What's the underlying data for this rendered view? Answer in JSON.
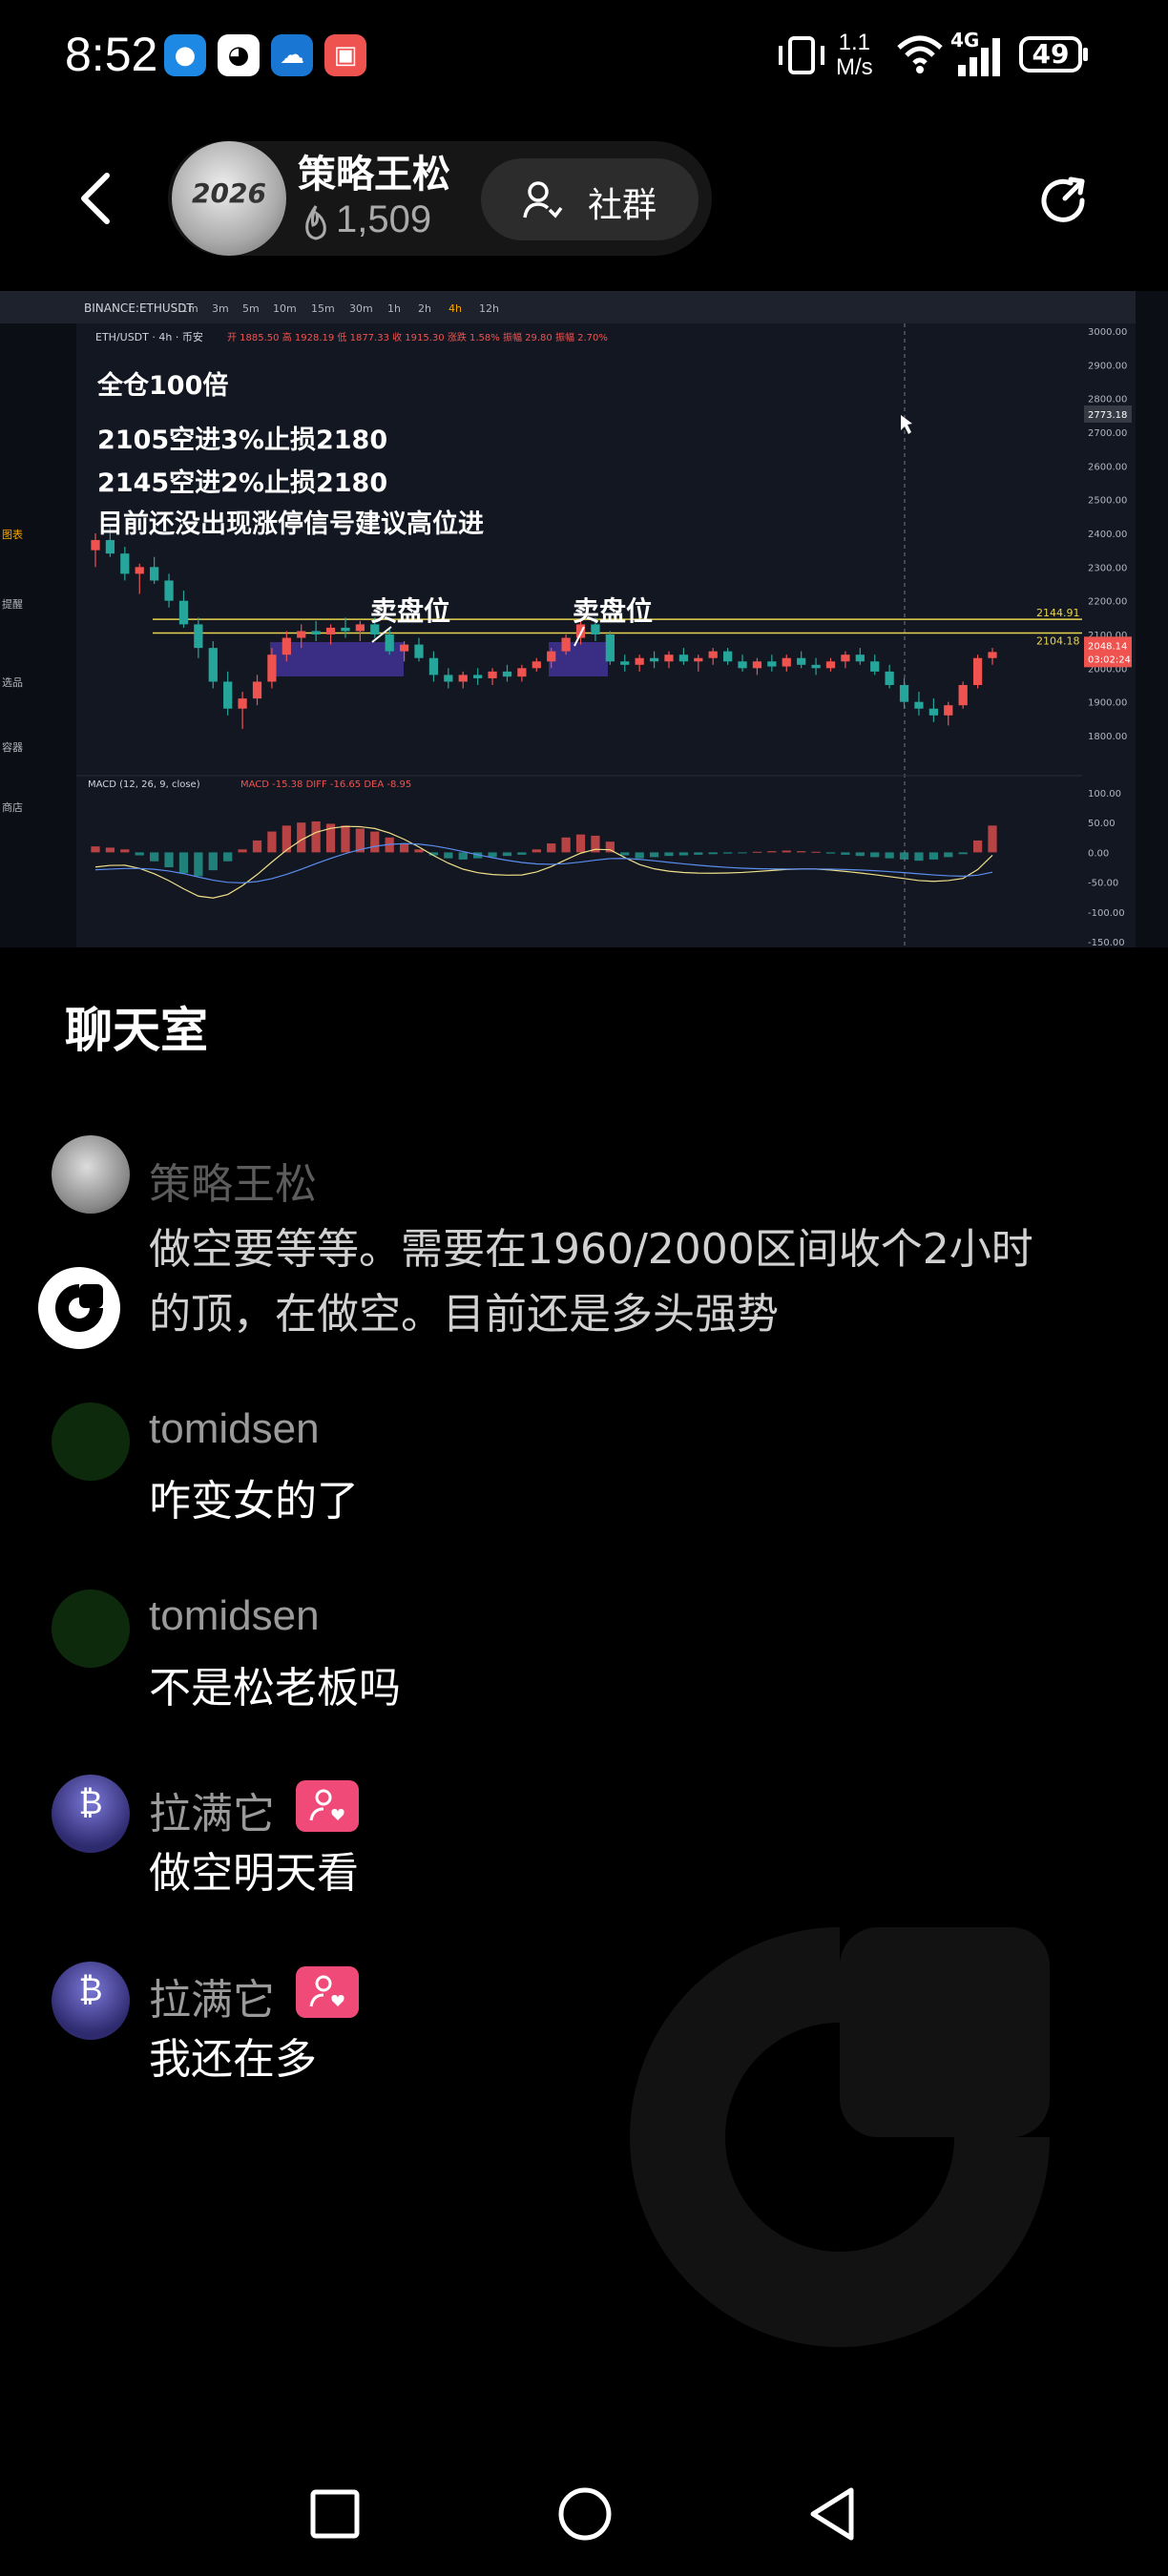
{
  "status_bar": {
    "time": "8:52",
    "network_speed_value": "1.1",
    "network_speed_unit": "M/s",
    "network_type": "4G",
    "battery": "49",
    "app_icons": [
      "message-app-icon",
      "qq-icon",
      "weather-app-icon",
      "red-app-icon"
    ]
  },
  "header": {
    "streamer_name": "策略王松",
    "fans_count": "1,509",
    "community_label": "社群",
    "avatar_text": "2026"
  },
  "chart_panel": {
    "symbol": "BINANCE:ETHUSDT",
    "timeframes": [
      "1m",
      "3m",
      "5m",
      "10m",
      "15m",
      "30m",
      "1h",
      "2h",
      "4h",
      "12h"
    ],
    "active_timeframe": "4h",
    "pair_label": "ETH/USDT · 4h · 币安",
    "ohlc_text": "开 1885.50  高 1928.19  低 1877.33  收 1915.30  涨跌 1.58%  振幅 29.80  振幅 2.70%",
    "annotation_lines": [
      "全仓100倍",
      "2105空进3%止损2180",
      "2145空进2%止损2180",
      "目前还没出现涨停信号建议高位进"
    ],
    "sell_zone_label_1": "卖盘位",
    "sell_zone_label_2": "卖盘位",
    "level_upper": "2144.91",
    "level_lower": "2104.18",
    "price_tag": "2048.14",
    "countdown_tag": "03:02:24",
    "crosshair_price": "2773.18",
    "macd_label": "MACD (12, 26, 9, close)",
    "macd_values": "MACD -15.38  DIFF -16.65  DEA -8.95",
    "left_toolbar_labels": [
      "图表",
      "提醒",
      "选品",
      "容器",
      "商店"
    ],
    "price_axis": [
      "3000.00",
      "2900.00",
      "2800.00",
      "2700.00",
      "2600.00",
      "2500.00",
      "2400.00",
      "2300.00",
      "2200.00",
      "2100.00",
      "2000.00",
      "1900.00",
      "1800.00"
    ],
    "macd_axis": [
      "100.00",
      "50.00",
      "0.00",
      "-50.00",
      "-100.00",
      "-150.00"
    ],
    "candles": [
      [
        2350,
        2400,
        2300,
        2380
      ],
      [
        2380,
        2420,
        2330,
        2340
      ],
      [
        2340,
        2360,
        2260,
        2280
      ],
      [
        2280,
        2310,
        2220,
        2300
      ],
      [
        2300,
        2330,
        2250,
        2260
      ],
      [
        2260,
        2280,
        2180,
        2200
      ],
      [
        2200,
        2230,
        2120,
        2130
      ],
      [
        2130,
        2150,
        2030,
        2060
      ],
      [
        2060,
        2080,
        1940,
        1960
      ],
      [
        1960,
        1990,
        1860,
        1880
      ],
      [
        1880,
        1930,
        1820,
        1910
      ],
      [
        1910,
        1980,
        1890,
        1960
      ],
      [
        1960,
        2060,
        1940,
        2040
      ],
      [
        2040,
        2110,
        2020,
        2090
      ],
      [
        2090,
        2130,
        2060,
        2110
      ],
      [
        2110,
        2140,
        2080,
        2100
      ],
      [
        2100,
        2130,
        2070,
        2120
      ],
      [
        2120,
        2150,
        2090,
        2110
      ],
      [
        2110,
        2140,
        2080,
        2130
      ],
      [
        2130,
        2150,
        2090,
        2100
      ],
      [
        2100,
        2120,
        2040,
        2050
      ],
      [
        2050,
        2080,
        2020,
        2070
      ],
      [
        2070,
        2090,
        2020,
        2030
      ],
      [
        2030,
        2050,
        1960,
        1980
      ],
      [
        1980,
        2000,
        1940,
        1960
      ],
      [
        1960,
        1990,
        1940,
        1980
      ],
      [
        1980,
        2000,
        1950,
        1970
      ],
      [
        1970,
        2000,
        1950,
        1990
      ],
      [
        1990,
        2010,
        1960,
        1975
      ],
      [
        1975,
        2010,
        1960,
        2000
      ],
      [
        2000,
        2030,
        1990,
        2020
      ],
      [
        2020,
        2060,
        2000,
        2050
      ],
      [
        2050,
        2100,
        2040,
        2090
      ],
      [
        2090,
        2140,
        2070,
        2130
      ],
      [
        2130,
        2150,
        2080,
        2100
      ],
      [
        2100,
        2110,
        2010,
        2020
      ],
      [
        2020,
        2040,
        1990,
        2010
      ],
      [
        2010,
        2040,
        1990,
        2030
      ],
      [
        2030,
        2050,
        2000,
        2020
      ],
      [
        2020,
        2050,
        2000,
        2040
      ],
      [
        2040,
        2060,
        2010,
        2020
      ],
      [
        2020,
        2040,
        1990,
        2030
      ],
      [
        2030,
        2060,
        2010,
        2050
      ],
      [
        2050,
        2060,
        2010,
        2020
      ],
      [
        2020,
        2040,
        1990,
        2000
      ],
      [
        2000,
        2030,
        1980,
        2020
      ],
      [
        2020,
        2040,
        1990,
        2005
      ],
      [
        2005,
        2040,
        1990,
        2030
      ],
      [
        2030,
        2050,
        2000,
        2010
      ],
      [
        2010,
        2030,
        1980,
        2000
      ],
      [
        2000,
        2030,
        1990,
        2020
      ],
      [
        2020,
        2050,
        2000,
        2040
      ],
      [
        2040,
        2060,
        2010,
        2020
      ],
      [
        2020,
        2040,
        1980,
        1990
      ],
      [
        1990,
        2010,
        1940,
        1950
      ],
      [
        1950,
        1970,
        1880,
        1900
      ],
      [
        1900,
        1930,
        1860,
        1880
      ],
      [
        1880,
        1910,
        1840,
        1860
      ],
      [
        1860,
        1900,
        1830,
        1890
      ],
      [
        1890,
        1960,
        1880,
        1950
      ],
      [
        1950,
        2040,
        1940,
        2030
      ],
      [
        2030,
        2060,
        2010,
        2048
      ]
    ],
    "macd_hist": [
      10,
      8,
      5,
      -5,
      -15,
      -25,
      -35,
      -40,
      -30,
      -15,
      5,
      20,
      35,
      45,
      50,
      52,
      48,
      45,
      40,
      35,
      25,
      15,
      5,
      -5,
      -10,
      -12,
      -10,
      -8,
      -6,
      -4,
      5,
      15,
      25,
      30,
      28,
      18,
      -5,
      -10,
      -8,
      -6,
      -5,
      -4,
      -3,
      -2,
      -1,
      1,
      2,
      3,
      2,
      1,
      -2,
      -4,
      -6,
      -8,
      -10,
      -12,
      -14,
      -12,
      -8,
      -3,
      20,
      45
    ]
  },
  "chat": {
    "title": "聊天室",
    "messages": [
      {
        "user": "策略王松",
        "text": "做空要等等。需要在1960/2000区间收个2小时的顶，在做空。目前还是多头强势",
        "text_line1": "做空要等等。需要在1960/2000区间收个2小时",
        "text_line2": "的顶，在做空。目前还是多头强势"
      },
      {
        "user": "tomidsen",
        "text": "咋变女的了"
      },
      {
        "user": "tomidsen",
        "text": "不是松老板吗"
      },
      {
        "user": "拉满它",
        "text": "做空明天看"
      },
      {
        "user": "拉满它",
        "text": "我还在多"
      }
    ]
  },
  "colors": {
    "up": "#ef5350",
    "down": "#26a69a",
    "level_line": "#e8d44d",
    "badge": "#f04a78",
    "chart_bg": "#131722"
  }
}
